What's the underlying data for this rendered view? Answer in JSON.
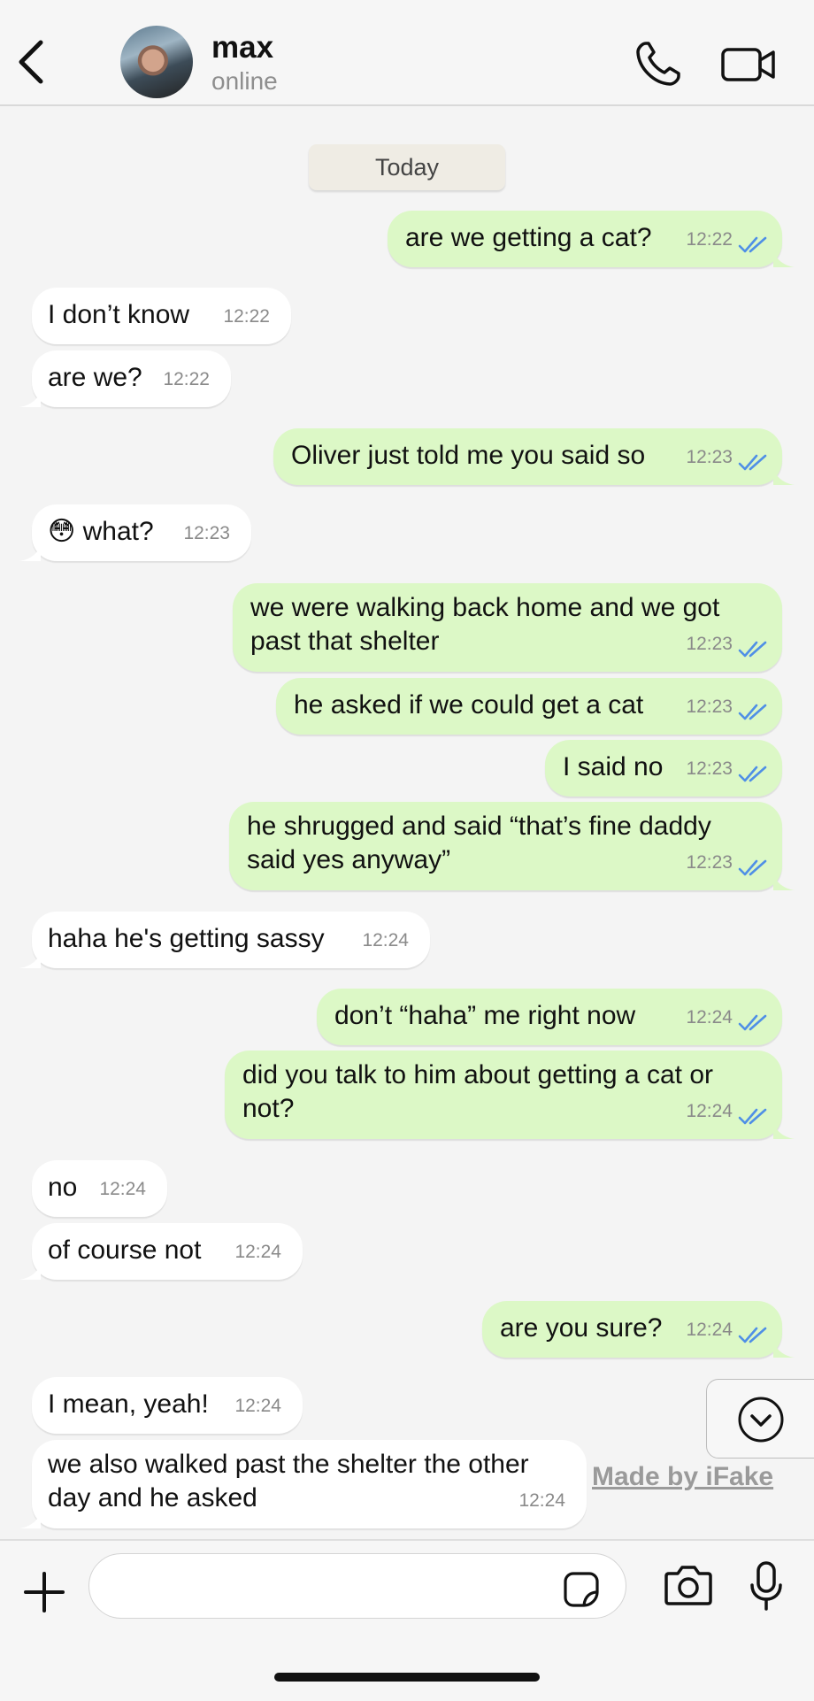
{
  "header": {
    "name": "max",
    "status": "online"
  },
  "date_divider": "Today",
  "messages": [
    {
      "dir": "out",
      "text": "are we getting a cat?",
      "time": "12:22",
      "read": true
    },
    {
      "dir": "in",
      "text": "I don’t know",
      "time": "12:22"
    },
    {
      "dir": "in",
      "text": "are we?",
      "time": "12:22"
    },
    {
      "dir": "out",
      "text": "Oliver just told me you said so",
      "time": "12:23",
      "read": true
    },
    {
      "dir": "in",
      "text": "😳 what?",
      "time": "12:23"
    },
    {
      "dir": "out",
      "text": "we were walking back home and we got\npast that shelter",
      "time": "12:23",
      "read": true
    },
    {
      "dir": "out",
      "text": "he asked if we could get a cat",
      "time": "12:23",
      "read": true
    },
    {
      "dir": "out",
      "text": "I said no",
      "time": "12:23",
      "read": true
    },
    {
      "dir": "out",
      "text": "he shrugged and said “that’s fine daddy\nsaid yes anyway”",
      "time": "12:23",
      "read": true
    },
    {
      "dir": "in",
      "text": "haha he's getting sassy",
      "time": "12:24"
    },
    {
      "dir": "out",
      "text": "don’t “haha” me right now",
      "time": "12:24",
      "read": true
    },
    {
      "dir": "out",
      "text": "did you talk to him about getting a cat or\nnot?",
      "time": "12:24",
      "read": true
    },
    {
      "dir": "in",
      "text": "no",
      "time": "12:24"
    },
    {
      "dir": "in",
      "text": "of course not",
      "time": "12:24"
    },
    {
      "dir": "out",
      "text": "are you sure?",
      "time": "12:24",
      "read": true
    },
    {
      "dir": "in",
      "text": "I mean, yeah!",
      "time": "12:24"
    },
    {
      "dir": "in",
      "text": "we also walked past the shelter the other\nday and he asked",
      "time": "12:24"
    }
  ],
  "watermark": "Made by iFake",
  "composer": {
    "placeholder": ""
  },
  "colors": {
    "outgoing_bubble": "#dcf8c6",
    "incoming_bubble": "#ffffff",
    "read_ticks": "#4f8fe6",
    "background": "#f4f4f4"
  },
  "icons": [
    "back-chevron-icon",
    "phone-icon",
    "video-camera-icon",
    "scroll-down-chevron-icon",
    "plus-icon",
    "sticker-icon",
    "camera-icon",
    "microphone-icon"
  ]
}
